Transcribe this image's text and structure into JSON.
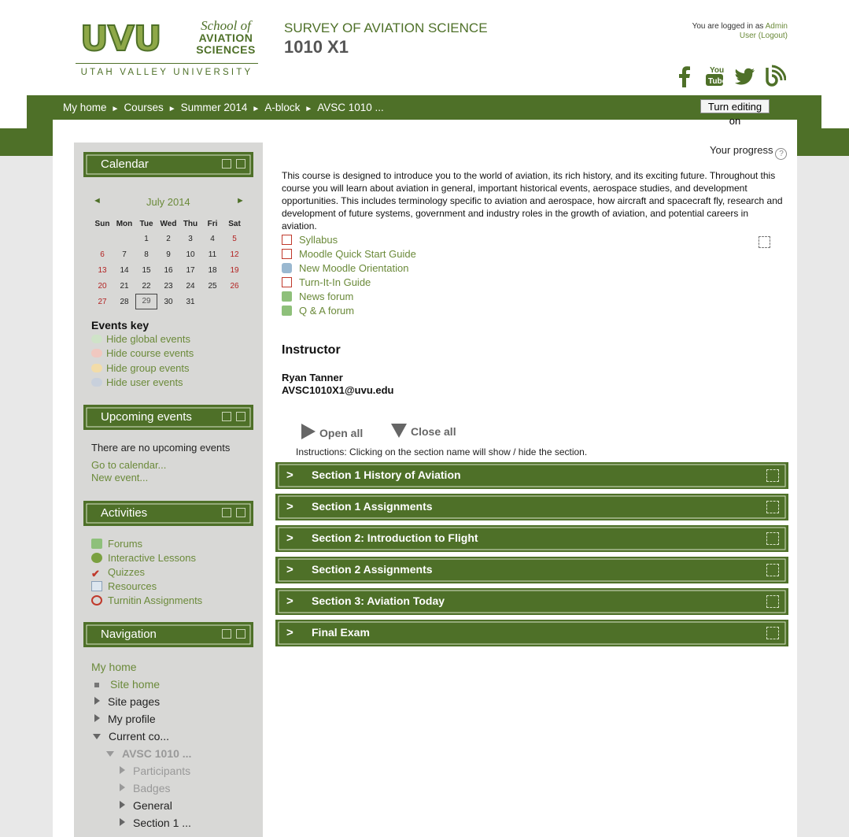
{
  "logo": {
    "uvu": "UVU",
    "school_of": "School of",
    "aviation": "AVIATION",
    "sciences": "SCIENCES",
    "university": "UTAH VALLEY UNIVERSITY"
  },
  "header": {
    "course_title": "SURVEY OF AVIATION SCIENCE",
    "course_code": "1010 X1",
    "login_prefix": "You are logged in as",
    "login_user_first": "Admin",
    "login_user_last": "User",
    "logout": "(Logout)"
  },
  "social": [
    "facebook-icon",
    "youtube-icon",
    "twitter-icon",
    "blog-icon"
  ],
  "breadcrumbs": [
    "My home",
    "Courses",
    "Summer 2014",
    "A-block",
    "AVSC 1010 ..."
  ],
  "edit_button": "Turn editing on",
  "calendar": {
    "title": "Calendar",
    "prev": "◄",
    "next": "►",
    "month": "July 2014",
    "days": [
      "Sun",
      "Mon",
      "Tue",
      "Wed",
      "Thu",
      "Fri",
      "Sat"
    ],
    "weeks": [
      [
        "",
        "",
        "1",
        "2",
        "3",
        "4",
        "5"
      ],
      [
        "6",
        "7",
        "8",
        "9",
        "10",
        "11",
        "12"
      ],
      [
        "13",
        "14",
        "15",
        "16",
        "17",
        "18",
        "19"
      ],
      [
        "20",
        "21",
        "22",
        "23",
        "24",
        "25",
        "26"
      ],
      [
        "27",
        "28",
        "29",
        "30",
        "31",
        "",
        ""
      ]
    ],
    "today": "29",
    "events_key": "Events key",
    "keys": [
      "Hide global events",
      "Hide course events",
      "Hide group events",
      "Hide user events"
    ]
  },
  "upcoming": {
    "title": "Upcoming events",
    "empty": "There are no upcoming events",
    "goto": "Go to calendar...",
    "new_event": "New event..."
  },
  "activities": {
    "title": "Activities",
    "items": [
      "Forums",
      "Interactive Lessons",
      "Quizzes",
      "Resources",
      "Turnitin Assignments"
    ]
  },
  "navigation": {
    "title": "Navigation",
    "my_home": "My home",
    "site_home": "Site home",
    "site_pages": "Site pages",
    "my_profile": "My profile",
    "current_courses": "Current co...",
    "course": "AVSC 1010 ...",
    "participants": "Participants",
    "badges": "Badges",
    "general": "General",
    "section1": "Section 1 ..."
  },
  "main": {
    "your_progress": "Your progress",
    "summary": "This course is designed to introduce you to the world of aviation, its rich history, and its exciting future. Throughout this course you will learn about aviation in general, important historical events, aerospace studies, and development opportunities. This includes terminology specific to aviation and aerospace, how aircraft and spacecraft fly, research and development of future systems, government and industry roles in the growth of aviation, and potential careers in aviation.",
    "resources": [
      "Syllabus",
      "Moodle Quick Start Guide",
      "New Moodle Orientation",
      "Turn-It-In Guide",
      "News forum",
      "Q & A forum"
    ],
    "instructor_heading": "Instructor",
    "instructor_name": "Ryan Tanner",
    "instructor_email": "AVSC1010X1@uvu.edu",
    "open_all": "Open all",
    "close_all": "Close all",
    "instructions": "Instructions: Clicking on the section name will show / hide the section.",
    "sections": [
      "Section 1 History of Aviation",
      "Section 1 Assignments",
      "Section 2: Introduction to Flight",
      "Section 2 Assignments",
      "Section 3: Aviation Today",
      "Final Exam"
    ]
  },
  "colors": {
    "brand_green": "#4e7028",
    "link_green": "#6b8a3a",
    "weekend_red": "#b22222"
  }
}
